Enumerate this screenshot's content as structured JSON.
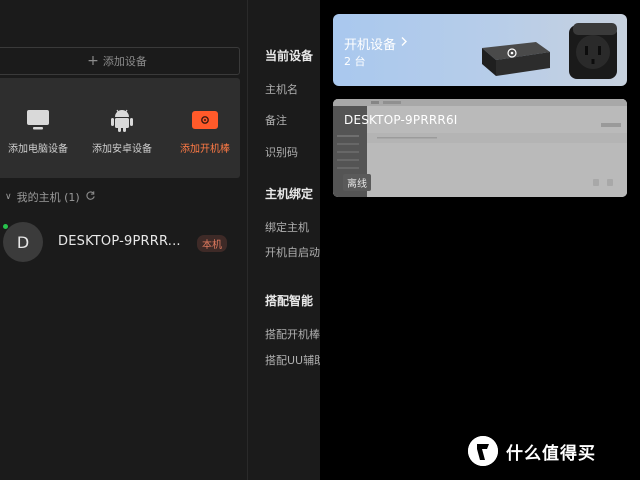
{
  "add_device": {
    "icon": "plus-icon",
    "label": "添加设备"
  },
  "quick_actions": [
    {
      "icon": "monitor-icon",
      "label": "添加电脑设备"
    },
    {
      "icon": "android-icon",
      "label": "添加安卓设备"
    },
    {
      "icon": "power-stick-icon",
      "label": "添加开机棒"
    }
  ],
  "hosts": {
    "section_label": "我的主机 (1)",
    "refresh_icon": "refresh-icon",
    "items": [
      {
        "avatar": "D",
        "name": "DESKTOP-9PRRR...",
        "badge": "本机",
        "online": true
      }
    ]
  },
  "details": {
    "section1_title": "当前设备",
    "section1_items": [
      "主机名",
      "备注",
      "识别码"
    ],
    "section2_title": "主机绑定",
    "section2_items": [
      "绑定主机",
      "开机自启动"
    ],
    "section3_title": "搭配智能",
    "section3_items": [
      "搭配开机棒",
      "搭配UU辅助"
    ]
  },
  "overlay": {
    "card_power_on": {
      "title": "开机设备",
      "count": "2 台",
      "arrow": "chevron-right-icon"
    },
    "card_desktop": {
      "host": "DESKTOP-9PRRR6I",
      "status": "离线"
    }
  },
  "watermark": {
    "logo": "值",
    "text": "什么值得买"
  },
  "colors": {
    "accent_orange": "#ff5a2a",
    "online_green": "#27c24c",
    "badge_text": "#e07a5f"
  }
}
